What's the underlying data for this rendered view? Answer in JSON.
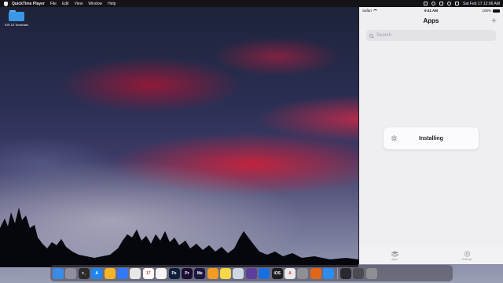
{
  "menubar": {
    "app_name": "QuickTime Player",
    "items": [
      "File",
      "Edit",
      "View",
      "Window",
      "Help"
    ],
    "datetime": "Sat Feb 17  12:06 AM"
  },
  "desktop": {
    "folder_label": "iOS 15 Toolchain"
  },
  "simulator": {
    "status": {
      "carrier": "Safari",
      "time": "9:41 AM",
      "battery": "100%"
    },
    "nav": {
      "title": "Apps",
      "add_label": "+"
    },
    "search": {
      "placeholder": "Search"
    },
    "installing_label": "Installing",
    "tabs": [
      {
        "label": "Apps",
        "icon": "stack-icon"
      },
      {
        "label": "Settings",
        "icon": "gear-icon"
      }
    ]
  },
  "dock": {
    "icons": [
      {
        "name": "finder-icon",
        "color": "#3a8be8",
        "glyph": ""
      },
      {
        "name": "launchpad-icon",
        "color": "#8f8fa0",
        "glyph": ""
      },
      {
        "name": "terminal-icon",
        "color": "#2b2b2b",
        "glyph": ">_"
      },
      {
        "name": "app-store-icon",
        "color": "#1f86f0",
        "glyph": "A"
      },
      {
        "name": "photos-icon",
        "color": "#f3b42a",
        "glyph": ""
      },
      {
        "name": "safari-icon",
        "color": "#3478f6",
        "glyph": ""
      },
      {
        "name": "chrome-icon",
        "color": "#e7e7e7",
        "glyph": ""
      },
      {
        "name": "calendar-icon",
        "color": "#ffffff",
        "glyph": "17"
      },
      {
        "name": "reminders-icon",
        "color": "#f4f4f4",
        "glyph": ""
      },
      {
        "name": "photoshop-icon",
        "color": "#0d1f3c",
        "glyph": "Ps"
      },
      {
        "name": "premiere-icon",
        "color": "#1a0f33",
        "glyph": "Pr"
      },
      {
        "name": "media-encoder-icon",
        "color": "#1b1740",
        "glyph": "Me"
      },
      {
        "name": "pages-icon",
        "color": "#f29b26",
        "glyph": ""
      },
      {
        "name": "notes-icon",
        "color": "#f7d74a",
        "glyph": ""
      },
      {
        "name": "preview-icon",
        "color": "#cfd7e6",
        "glyph": ""
      },
      {
        "name": "github-icon",
        "color": "#5e3e9c",
        "glyph": ""
      },
      {
        "name": "xcode-icon",
        "color": "#1a6fe0",
        "glyph": ""
      },
      {
        "name": "ios-dev-icon",
        "color": "#1d1d1d",
        "glyph": "iOS"
      },
      {
        "name": "font-book-icon",
        "color": "#e9e9e9",
        "glyph": "A"
      },
      {
        "name": "system-preferences-icon",
        "color": "#8e8e93",
        "glyph": ""
      },
      {
        "name": "firefox-icon",
        "color": "#e2661a",
        "glyph": ""
      },
      {
        "name": "messenger-icon",
        "color": "#2d8cf0",
        "glyph": ""
      }
    ],
    "right_icons": [
      {
        "name": "screenshot-icon",
        "color": "#2a2a2e",
        "glyph": ""
      },
      {
        "name": "downloads-icon",
        "color": "#4b4b52",
        "glyph": ""
      },
      {
        "name": "trash-icon",
        "color": "#8e8e93",
        "glyph": ""
      }
    ]
  }
}
